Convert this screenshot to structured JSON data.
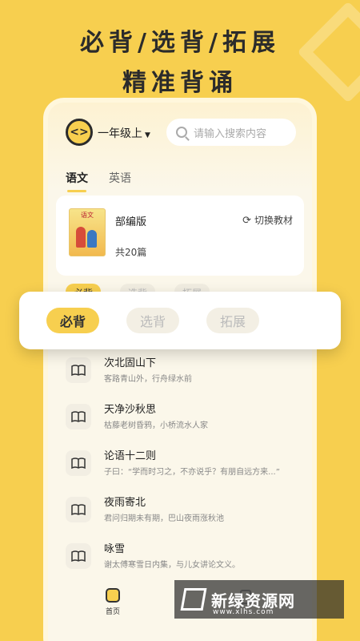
{
  "headline": {
    "line1": "必背/选背/拓展",
    "line2": "精准背诵"
  },
  "header": {
    "logo_text": "<>",
    "grade": "一年级上",
    "search_placeholder": "请输入搜索内容"
  },
  "tabs": [
    {
      "label": "语文"
    },
    {
      "label": "英语"
    }
  ],
  "book": {
    "cover_text": "语文",
    "edition": "部编版",
    "switch_label": "切换教材",
    "count": "共20篇"
  },
  "categories": [
    {
      "label": "必背"
    },
    {
      "label": "选背"
    },
    {
      "label": "拓展"
    }
  ],
  "list": [
    {
      "title": "次北固山下",
      "line": "客路青山外，行舟绿水前"
    },
    {
      "title": "天净沙秋思",
      "line": "枯藤老树昏鸦，小桥流水人家"
    },
    {
      "title": "论语十二则",
      "line": "子曰：“学而时习之，不亦说乎？有朋自远方来...”"
    },
    {
      "title": "夜雨寄北",
      "line": "君问归期未有期，巴山夜雨涨秋池"
    },
    {
      "title": "咏雪",
      "line": "谢太傅寒雪日内集，与儿女讲论文义。"
    }
  ],
  "tabbar": {
    "home": "首页"
  },
  "watermark": {
    "name": "新绿资源网",
    "domain": "www.xlhs.com"
  }
}
